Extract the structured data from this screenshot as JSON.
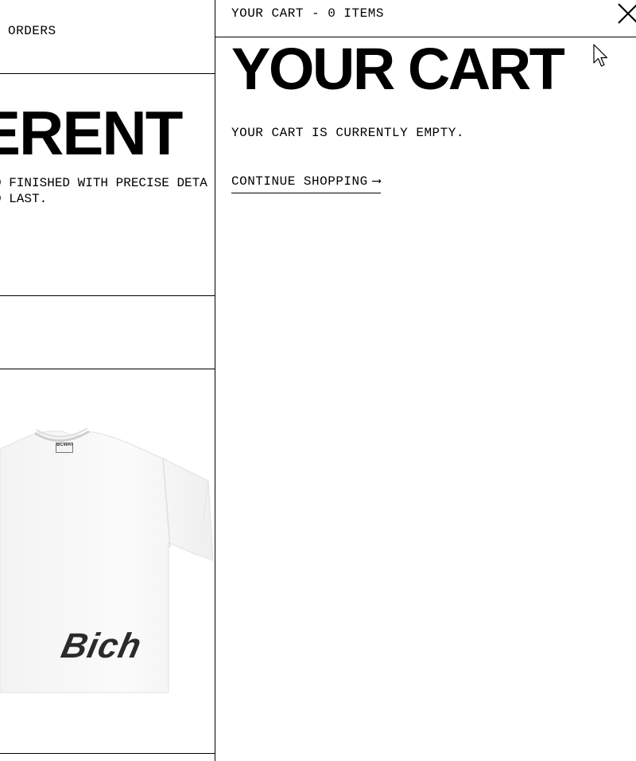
{
  "background_page": {
    "nav_orders": "ORDERS",
    "headline": "ERENT",
    "description_line1": "D FINISHED WITH PRECISE DETA",
    "description_line2": "D LAST.",
    "product_print": "Bich",
    "tag_text": "BCWAT"
  },
  "cart_drawer": {
    "header_count": "YOUR CART - 0 ITEMS",
    "title": "YOUR CART",
    "empty_message": "YOUR CART IS CURRENTLY EMPTY.",
    "continue_label": "CONTINUE SHOPPING",
    "continue_arrow": "⟶",
    "close_icon": "close-icon"
  },
  "colors": {
    "text": "#000000",
    "background": "#ffffff"
  }
}
